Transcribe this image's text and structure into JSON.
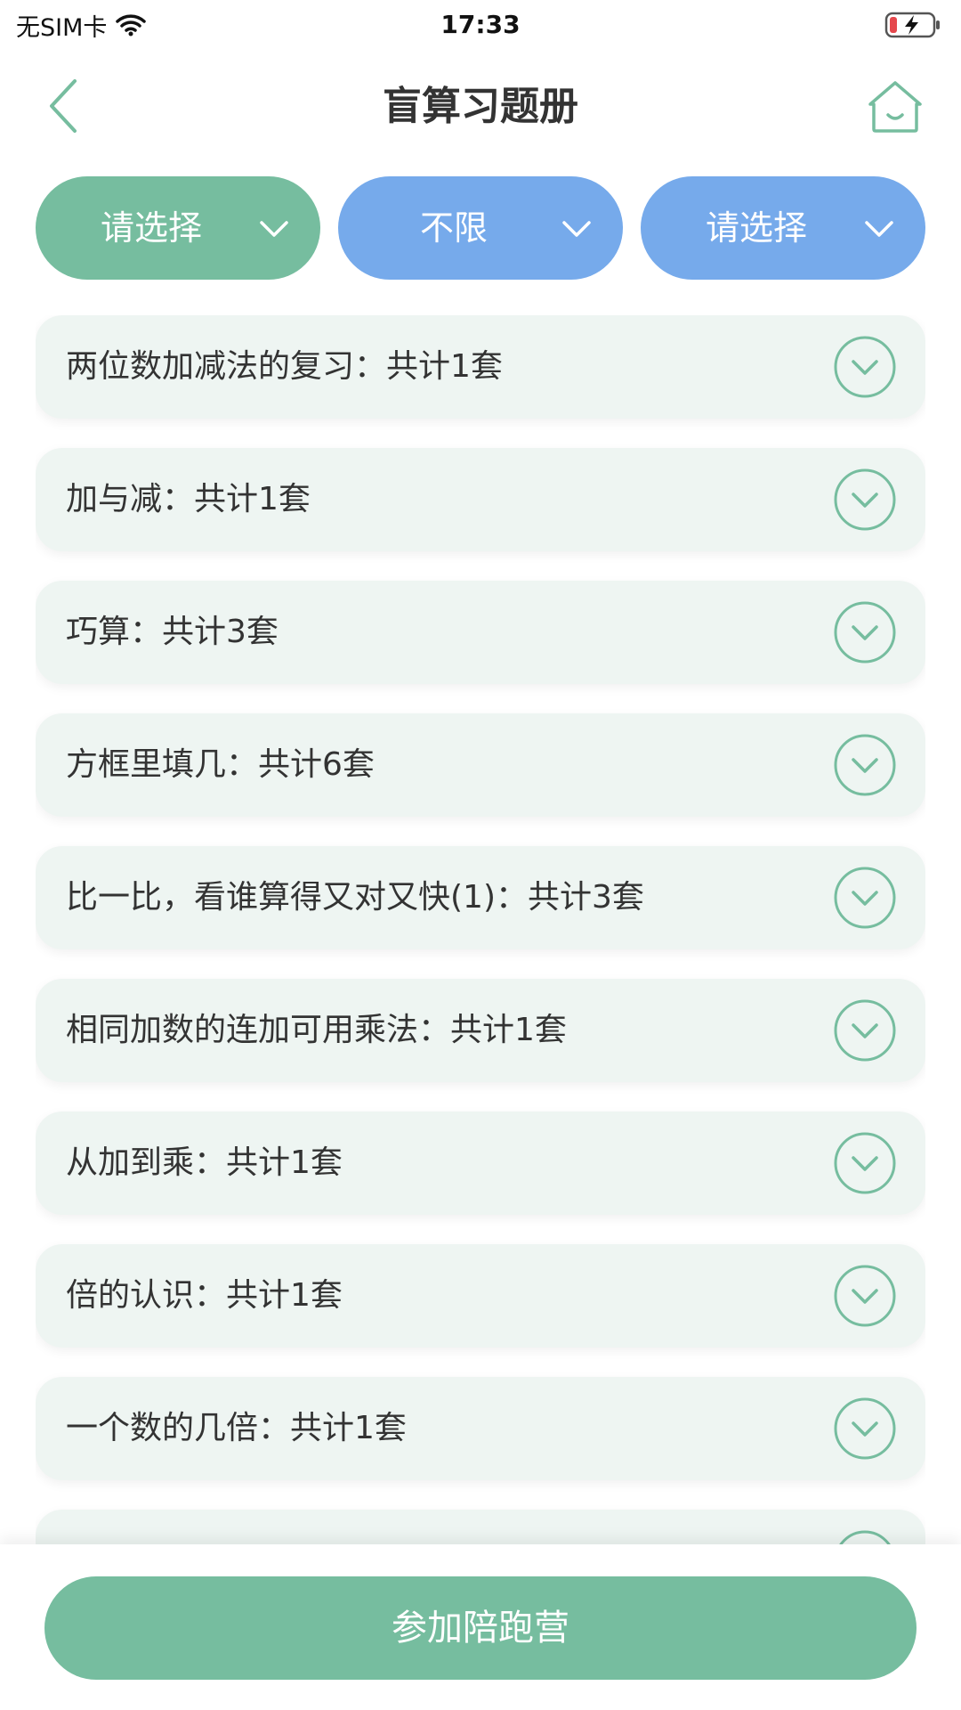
{
  "status_bar": {
    "carrier": "无SIM卡",
    "time": "17:33",
    "wifi_icon": "wifi-icon",
    "battery_icon": "battery-charging-icon"
  },
  "nav": {
    "title": "盲算习题册",
    "back_icon": "chevron-left-icon",
    "home_icon": "home-icon"
  },
  "filters": [
    {
      "label": "请选择",
      "color": "#76bd9f"
    },
    {
      "label": "不限",
      "color": "#76aaeb"
    },
    {
      "label": "请选择",
      "color": "#76aaeb"
    }
  ],
  "list": {
    "items": [
      {
        "label": "两位数加减法的复习：共计1套"
      },
      {
        "label": "加与减：共计1套"
      },
      {
        "label": "巧算：共计3套"
      },
      {
        "label": "方框里填几：共计6套"
      },
      {
        "label": "比一比，看谁算得又对又快(1)：共计3套"
      },
      {
        "label": "相同加数的连加可用乘法：共计1套"
      },
      {
        "label": "从加到乘：共计1套"
      },
      {
        "label": "倍的认识：共计1套"
      },
      {
        "label": "一个数的几倍：共计1套"
      }
    ]
  },
  "bottom": {
    "join_label": "参加陪跑营"
  },
  "colors": {
    "accent_green": "#76bd9f",
    "accent_blue": "#76aaeb",
    "item_bg": "#eef5f2"
  }
}
